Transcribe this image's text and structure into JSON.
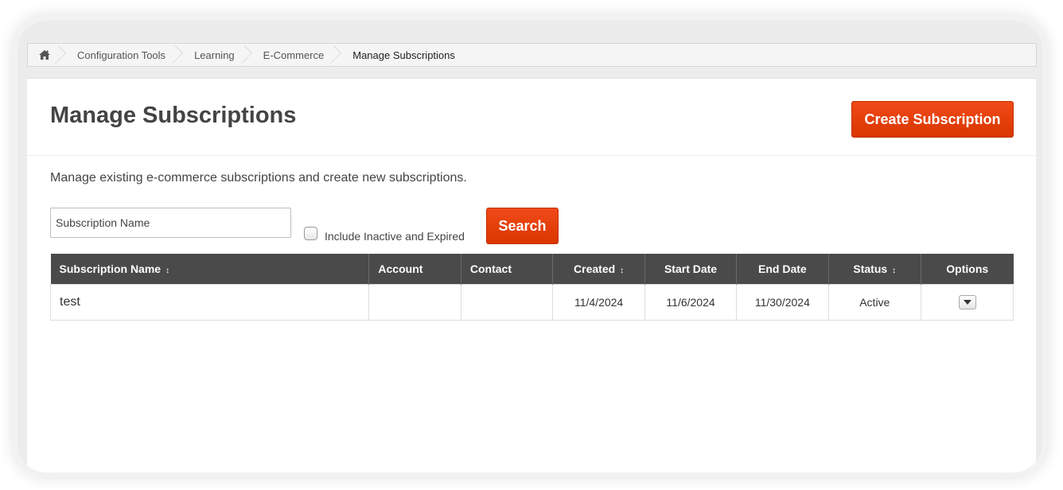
{
  "breadcrumb": {
    "home_icon": "home-icon",
    "items": [
      "Configuration Tools",
      "Learning",
      "E-Commerce",
      "Manage Subscriptions"
    ]
  },
  "page": {
    "title": "Manage Subscriptions",
    "create_button": "Create Subscription",
    "description": "Manage existing e-commerce subscriptions and create new subscriptions."
  },
  "search": {
    "placeholder": "Subscription Name",
    "include_inactive_label": "Include Inactive and Expired",
    "search_button": "Search"
  },
  "table": {
    "columns": [
      {
        "label": "Subscription Name",
        "sortable": true
      },
      {
        "label": "Account",
        "sortable": false
      },
      {
        "label": "Contact",
        "sortable": false
      },
      {
        "label": "Created",
        "sortable": true
      },
      {
        "label": "Start Date",
        "sortable": false
      },
      {
        "label": "End Date",
        "sortable": false
      },
      {
        "label": "Status",
        "sortable": true
      },
      {
        "label": "Options",
        "sortable": false
      }
    ],
    "rows": [
      {
        "name": "test",
        "account": "",
        "contact": "",
        "created": "11/4/2024",
        "start_date": "11/6/2024",
        "end_date": "11/30/2024",
        "status": "Active"
      }
    ]
  },
  "colors": {
    "accent": "#e53f0a",
    "header_bg": "#4a4a4a"
  }
}
